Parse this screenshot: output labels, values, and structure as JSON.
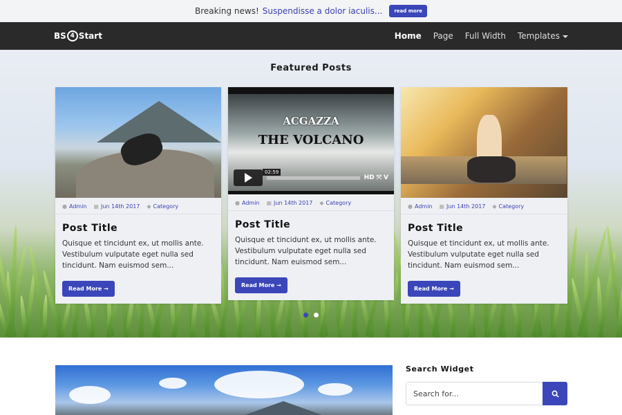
{
  "topbar": {
    "prefix": "Breaking news!",
    "link": "Suspendisse a dolor iaculis...",
    "button": "read more"
  },
  "navbar": {
    "brand_left": "BS",
    "brand_mid": "4",
    "brand_right": "Start",
    "items": [
      {
        "label": "Home",
        "active": true
      },
      {
        "label": "Page"
      },
      {
        "label": "Full Width"
      },
      {
        "label": "Templates"
      }
    ]
  },
  "hero": {
    "title": "Featured Posts",
    "cards": [
      {
        "author": "Admin",
        "date": "Jun 14th 2017",
        "category": "Category",
        "title": "Post Title",
        "excerpt": "Quisque et tincidunt ex, ut mollis ante. Vestibulum vulputate eget nulla sed tincidunt. Nam euismod sem...",
        "button": "Read More →"
      },
      {
        "author": "Admin",
        "date": "Jun 14th 2017",
        "category": "Category",
        "title": "Post Title",
        "excerpt": "Quisque et tincidunt ex, ut mollis ante. Vestibulum vulputate eget nulla sed tincidunt. Nam euismod sem...",
        "button": "Read More →",
        "video": {
          "title_top": "ACGAZZA",
          "title_main": "THE VOLCANO",
          "time": "02:59",
          "icons": "HD ⤧ V"
        }
      },
      {
        "author": "Admin",
        "date": "Jun 14th 2017",
        "category": "Category",
        "title": "Post Title",
        "excerpt": "Quisque et tincidunt ex, ut mollis ante. Vestibulum vulputate eget nulla sed tincidunt. Nam euismod sem...",
        "button": "Read More →"
      }
    ],
    "slides": 2,
    "active_slide": 1
  },
  "sidebar": {
    "widget_title": "Search Widget",
    "search_placeholder": "Search for..."
  },
  "colors": {
    "accent": "#3a46b9",
    "navbar": "#2a2a2a"
  }
}
